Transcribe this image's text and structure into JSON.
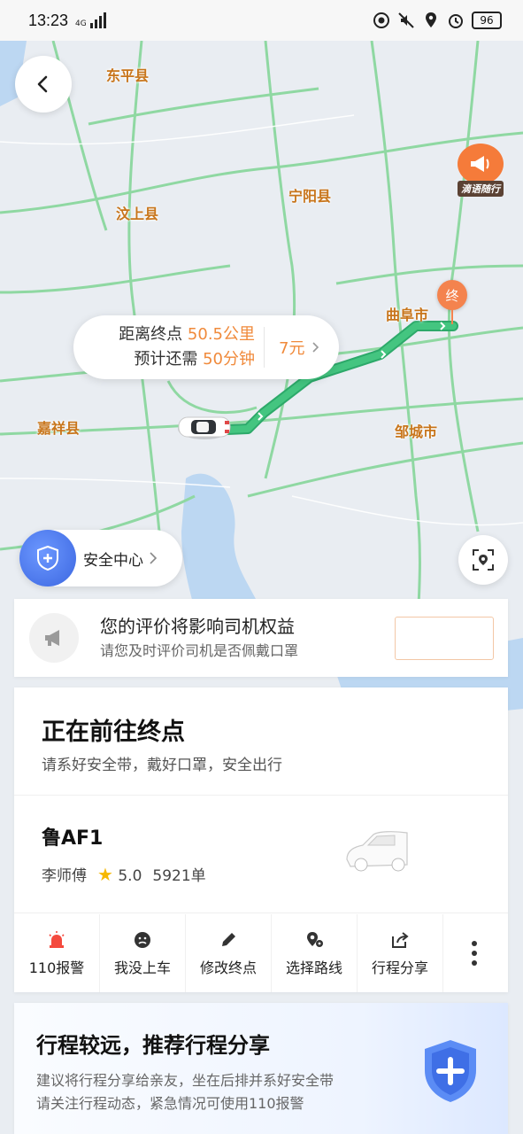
{
  "status_bar": {
    "time": "13:23",
    "network": "4G",
    "battery": "96"
  },
  "map": {
    "cities": [
      {
        "name": "东平县"
      },
      {
        "name": "宁阳县"
      },
      {
        "name": "汶上县"
      },
      {
        "name": "曲阜市"
      },
      {
        "name": "嘉祥县"
      },
      {
        "name": "邹城市"
      }
    ],
    "end_marker_label": "终",
    "broadcast_tag": "滴语随行",
    "colors": {
      "route": "#33b877",
      "accent": "#f08a3b",
      "shield": "#3b66e0"
    }
  },
  "trip_bubble": {
    "distance_prefix": "距离终点",
    "distance_value": "50.5公里",
    "time_prefix": "预计还需",
    "time_value": "50分钟",
    "fare": "7元"
  },
  "safety_center": {
    "label": "安全中心"
  },
  "evaluation": {
    "title": "您的评价将影响司机权益",
    "subtitle": "请您及时评价司机是否佩戴口罩",
    "button_label": ""
  },
  "ride": {
    "status": "正在前往终点",
    "hint": "请系好安全带，戴好口罩，安全出行",
    "plate": "鲁AF1",
    "driver_name": "李师傅",
    "rating": "5.0",
    "orders": "5921单"
  },
  "actions": [
    {
      "label": "110报警",
      "icon": "alarm-icon"
    },
    {
      "label": "我没上车",
      "icon": "sad-face-icon"
    },
    {
      "label": "修改终点",
      "icon": "pencil-icon"
    },
    {
      "label": "选择路线",
      "icon": "route-pin-icon"
    },
    {
      "label": "行程分享",
      "icon": "share-icon"
    }
  ],
  "share_promo": {
    "title": "行程较远，推荐行程分享",
    "line1": "建议将行程分享给亲友，坐在后排并系好安全带",
    "line2": "请关注行程动态，紧急情况可使用110报警"
  }
}
